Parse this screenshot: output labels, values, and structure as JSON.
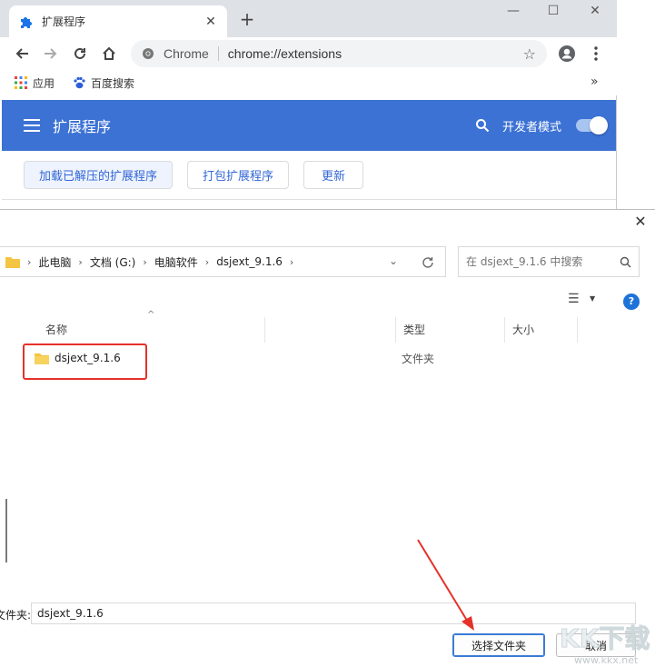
{
  "browser": {
    "tab_title": "扩展程序",
    "site_label": "Chrome",
    "url": "chrome://extensions",
    "bookmarks": [
      {
        "label": "应用",
        "icon": "apps-grid-icon"
      },
      {
        "label": "百度搜索",
        "icon": "baidu-paw-icon"
      }
    ]
  },
  "extensions_page": {
    "title": "扩展程序",
    "developer_mode_label": "开发者模式",
    "developer_mode_on": true,
    "actions": [
      "加载已解压的扩展程序",
      "打包扩展程序",
      "更新"
    ],
    "accent": "#3c72d4"
  },
  "dialog": {
    "breadcrumb": [
      "此电脑",
      "文档 (G:)",
      "电脑软件",
      "dsjext_9.1.6"
    ],
    "search_placeholder": "在 dsjext_9.1.6 中搜索",
    "columns": {
      "name": "名称",
      "type": "类型",
      "size": "大小"
    },
    "files": [
      {
        "name": "dsjext_9.1.6",
        "type": "文件夹",
        "size": ""
      }
    ],
    "folder_label": "文件夹:",
    "folder_value": "dsjext_9.1.6",
    "select_button": "选择文件夹",
    "cancel_button": "取消"
  },
  "watermark": {
    "text": "KK下载",
    "site": "www.kkx.net"
  }
}
